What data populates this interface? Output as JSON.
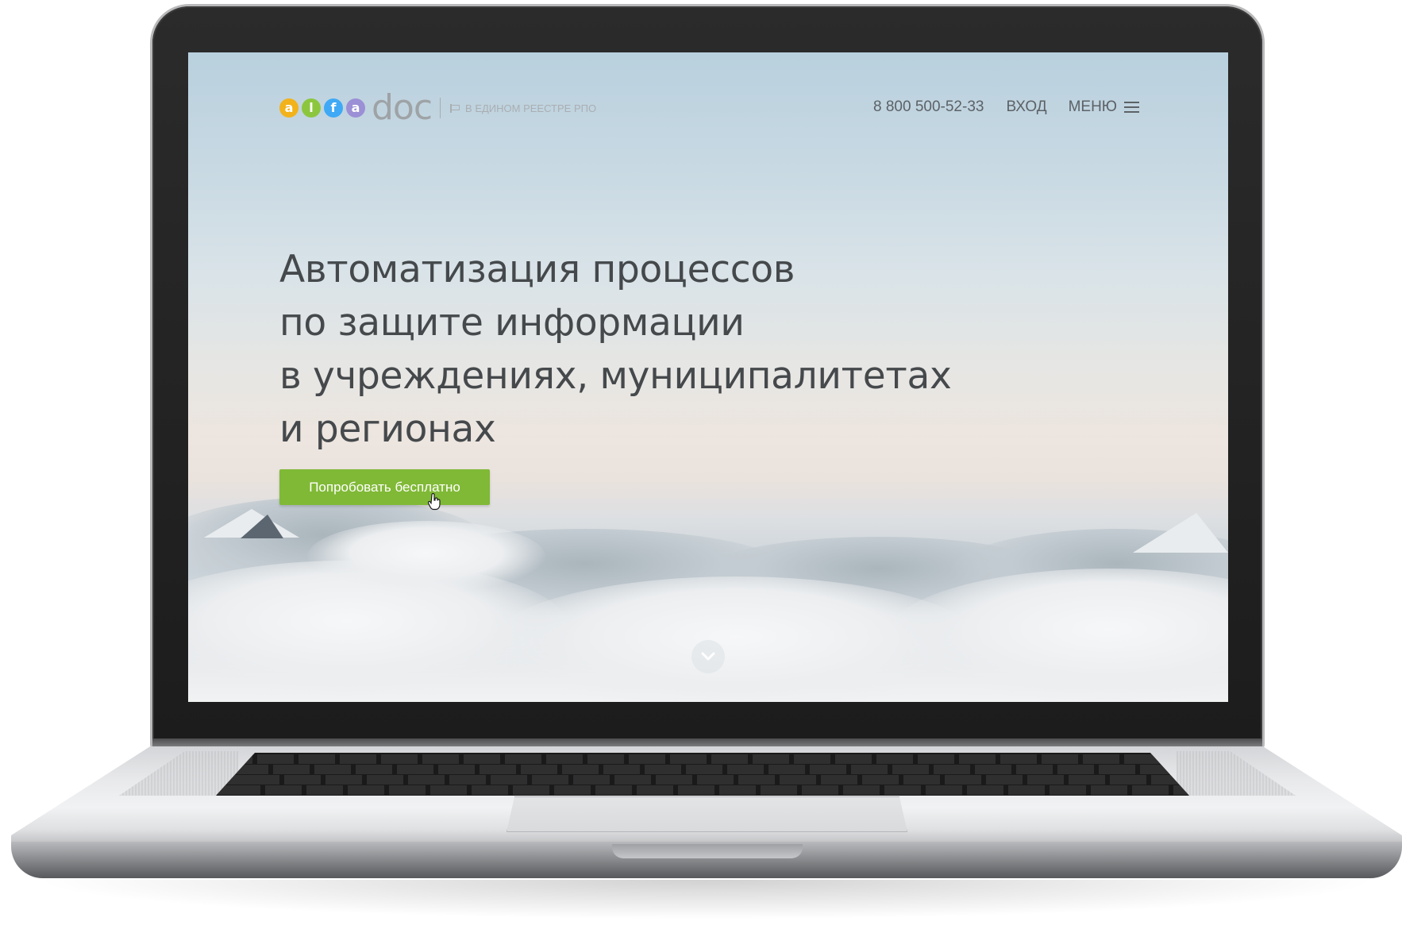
{
  "colors": {
    "accent_green": "#80b936",
    "logo_letters": [
      "#f2b21b",
      "#8cc63f",
      "#3fa9f5",
      "#9b8fd6"
    ],
    "heading": "#45494c",
    "nav_text": "#5c6266"
  },
  "header": {
    "logo": {
      "letters": [
        "a",
        "l",
        "f",
        "a"
      ],
      "word": "doc"
    },
    "registry_note": "В ЕДИНОМ РЕЕСТРЕ РПО",
    "registry_icon": "flag-icon",
    "phone": "8 800 500-52-33",
    "login": "ВХОД",
    "menu": "МЕНЮ",
    "menu_icon": "burger-icon"
  },
  "hero": {
    "title_lines": [
      "Автоматизация процессов",
      "по защите информации",
      "в учреждениях, муниципалитетах",
      "и регионах"
    ],
    "cta_label": "Попробовать бесплатно",
    "scroll_icon": "chevron-down-icon"
  }
}
